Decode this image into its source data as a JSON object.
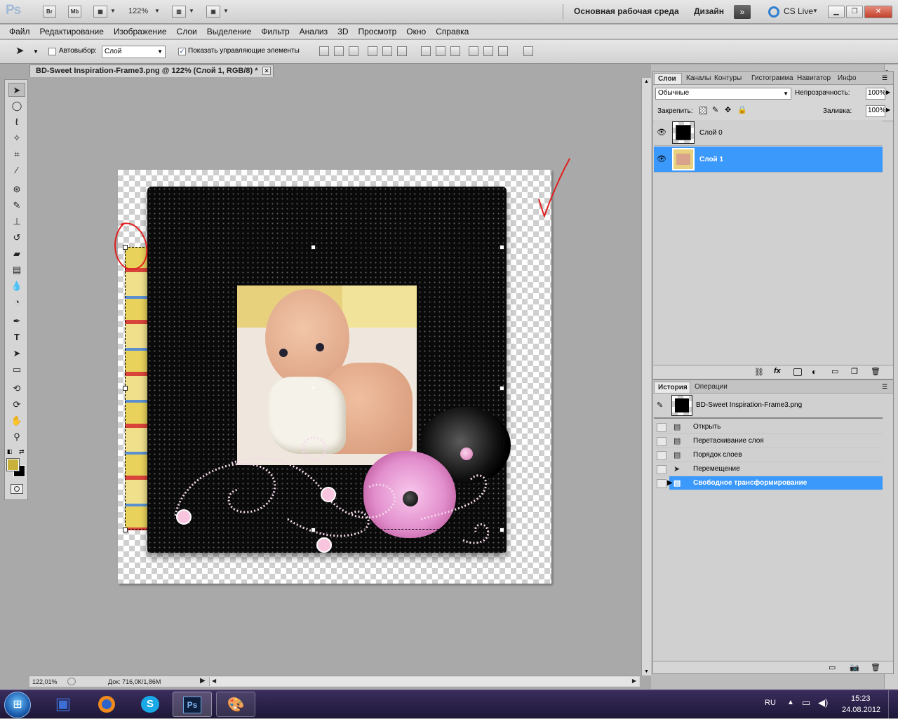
{
  "app": {
    "logo": "Ps",
    "bridge": "Br",
    "mini_bridge": "Mb",
    "zoom": "122%"
  },
  "workspace": {
    "essentials": "Основная рабочая среда",
    "design": "Дизайн",
    "cs_live": "CS Live"
  },
  "menu": [
    "Файл",
    "Редактирование",
    "Изображение",
    "Слои",
    "Выделение",
    "Фильтр",
    "Анализ",
    "3D",
    "Просмотр",
    "Окно",
    "Справка"
  ],
  "options": {
    "auto_select_label": "Автовыбор:",
    "auto_select_value": "Слой",
    "show_controls_label": "Показать управляющие элементы"
  },
  "document": {
    "tab_title": "BD-Sweet Inspiration-Frame3.png @ 122% (Слой 1, RGB/8) *"
  },
  "layers_panel": {
    "tabs": [
      "Слои",
      "Каналы",
      "Контуры",
      "Гистограмма",
      "Навигатор",
      "Инфо"
    ],
    "blend_mode": "Обычные",
    "opacity_label": "Непрозрачность:",
    "opacity_value": "100%",
    "lock_label": "Закрепить:",
    "fill_label": "Заливка:",
    "fill_value": "100%",
    "layers": [
      {
        "name": "Слой 0",
        "selected": false
      },
      {
        "name": "Слой 1",
        "selected": true
      }
    ]
  },
  "history_panel": {
    "tabs": [
      "История",
      "Операции"
    ],
    "snapshot": "BD-Sweet Inspiration-Frame3.png",
    "steps": [
      "Открыть",
      "Перетаскивание слоя",
      "Порядок слоев",
      "Перемещение",
      "Свободное трансформирование"
    ],
    "active_step": 4
  },
  "status": {
    "zoom": "122,01%",
    "doc": "Док: 716,0К/1,86М"
  },
  "taskbar": {
    "lang": "RU",
    "time": "15:23",
    "date": "24.08.2012",
    "ps_label": "Ps"
  },
  "colors": {
    "selection": "#3b99fc",
    "foreground_color": "#c8b23b",
    "annotation": "#e0201f"
  }
}
